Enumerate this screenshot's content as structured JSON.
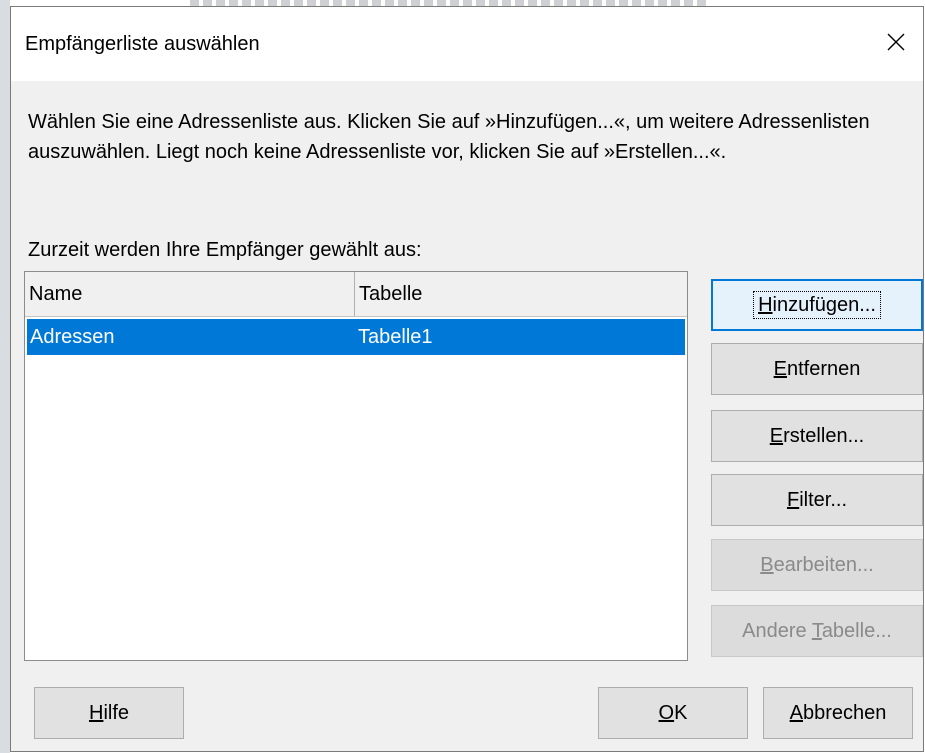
{
  "dialog": {
    "title": "Empfängerliste auswählen",
    "description": "Wählen Sie eine Adressenliste aus. Klicken Sie auf »Hinzufügen...«, um weitere Adressenlisten auszuwählen. Liegt noch keine Adressenliste vor, klicken Sie auf »Erstellen...«.",
    "list_caption": "Zurzeit werden Ihre Empfänger gewählt aus:"
  },
  "list": {
    "columns": {
      "name": "Name",
      "table": "Tabelle"
    },
    "rows": [
      {
        "name": "Adressen",
        "table": "Tabelle1",
        "selected": true
      }
    ]
  },
  "buttons": {
    "add": {
      "mnemonic": "H",
      "rest": "inzufügen..."
    },
    "remove": {
      "mnemonic": "E",
      "rest": "ntfernen"
    },
    "create": {
      "mnemonic": "E",
      "rest": "rstellen..."
    },
    "filter": {
      "mnemonic": "F",
      "rest": "ilter..."
    },
    "edit": {
      "mnemonic": "B",
      "rest": "earbeiten...",
      "disabled": true
    },
    "other_table": {
      "before": "Andere ",
      "mnemonic": "T",
      "rest": "abelle...",
      "disabled": true
    },
    "help": {
      "mnemonic": "H",
      "rest": "ilfe"
    },
    "ok": {
      "mnemonic": "O",
      "rest": "K"
    },
    "cancel": {
      "mnemonic": "A",
      "rest": "bbrechen"
    }
  },
  "colors": {
    "selection": "#0078d7",
    "dialog_bg": "#f0f0f0",
    "disabled_text": "#8a8a8a"
  },
  "icons": {
    "close": "close-icon"
  }
}
